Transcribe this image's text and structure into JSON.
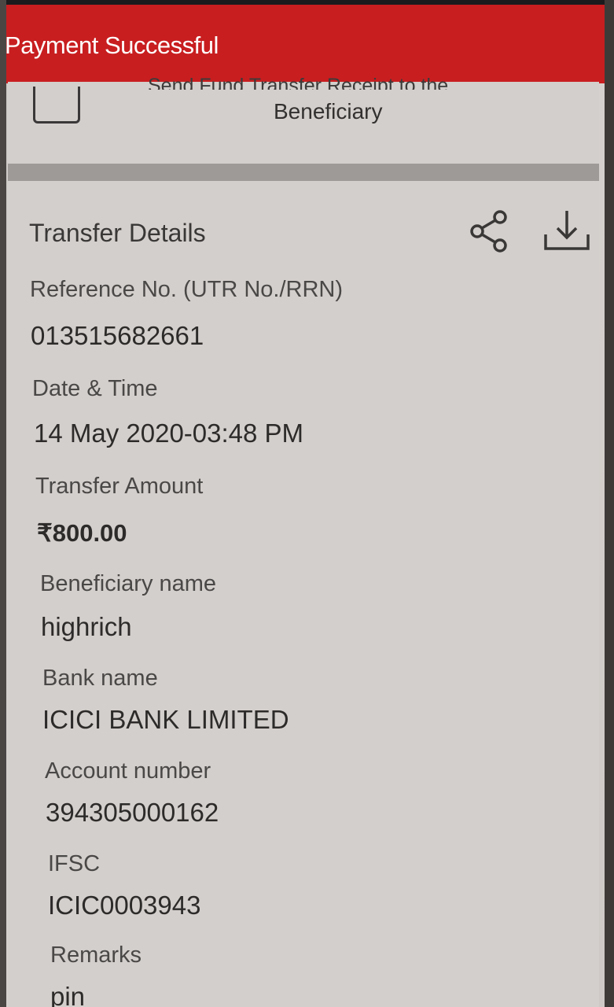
{
  "header": {
    "title": "Payment Successful"
  },
  "receipt_option": {
    "label_clipped": "Send Fund Transfer Receipt to the",
    "label": "Beneficiary"
  },
  "transfer_details": {
    "title": "Transfer Details",
    "share_icon": "share-icon",
    "download_icon": "download-icon",
    "fields": {
      "reference": {
        "label": "Reference No. (UTR No./RRN)",
        "value": "013515682661"
      },
      "datetime": {
        "label": "Date & Time",
        "value": "14 May 2020-03:48 PM"
      },
      "amount": {
        "label": "Transfer Amount",
        "value": "₹800.00"
      },
      "beneficiary": {
        "label": "Beneficiary name",
        "value": "highrich"
      },
      "bank": {
        "label": "Bank name",
        "value": "ICICI BANK LIMITED"
      },
      "account": {
        "label": "Account number",
        "value": "394305000162"
      },
      "ifsc": {
        "label": "IFSC",
        "value": "ICIC0003943"
      },
      "remarks": {
        "label": "Remarks",
        "value": "pin"
      }
    }
  },
  "colors": {
    "header": "#c81e20",
    "card": "#d3cfcc",
    "text": "#2d2b2a"
  }
}
